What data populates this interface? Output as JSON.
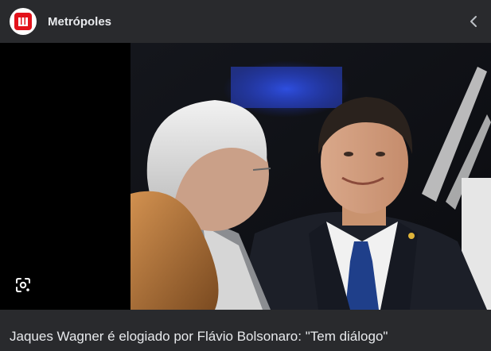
{
  "header": {
    "site_name": "Metrópoles",
    "logo_icon": "metropoles-logo-icon",
    "back_icon": "chevron-left-icon"
  },
  "media": {
    "image_subject": "news photo",
    "lens_icon": "google-lens-icon"
  },
  "caption": {
    "title": "Jaques Wagner é elogiado por Flávio Bolsonaro: \"Tem diálogo\""
  },
  "colors": {
    "background": "#202124",
    "header_bg": "#292a2d",
    "text": "#e8eaed",
    "brand_red": "#e3121b"
  }
}
